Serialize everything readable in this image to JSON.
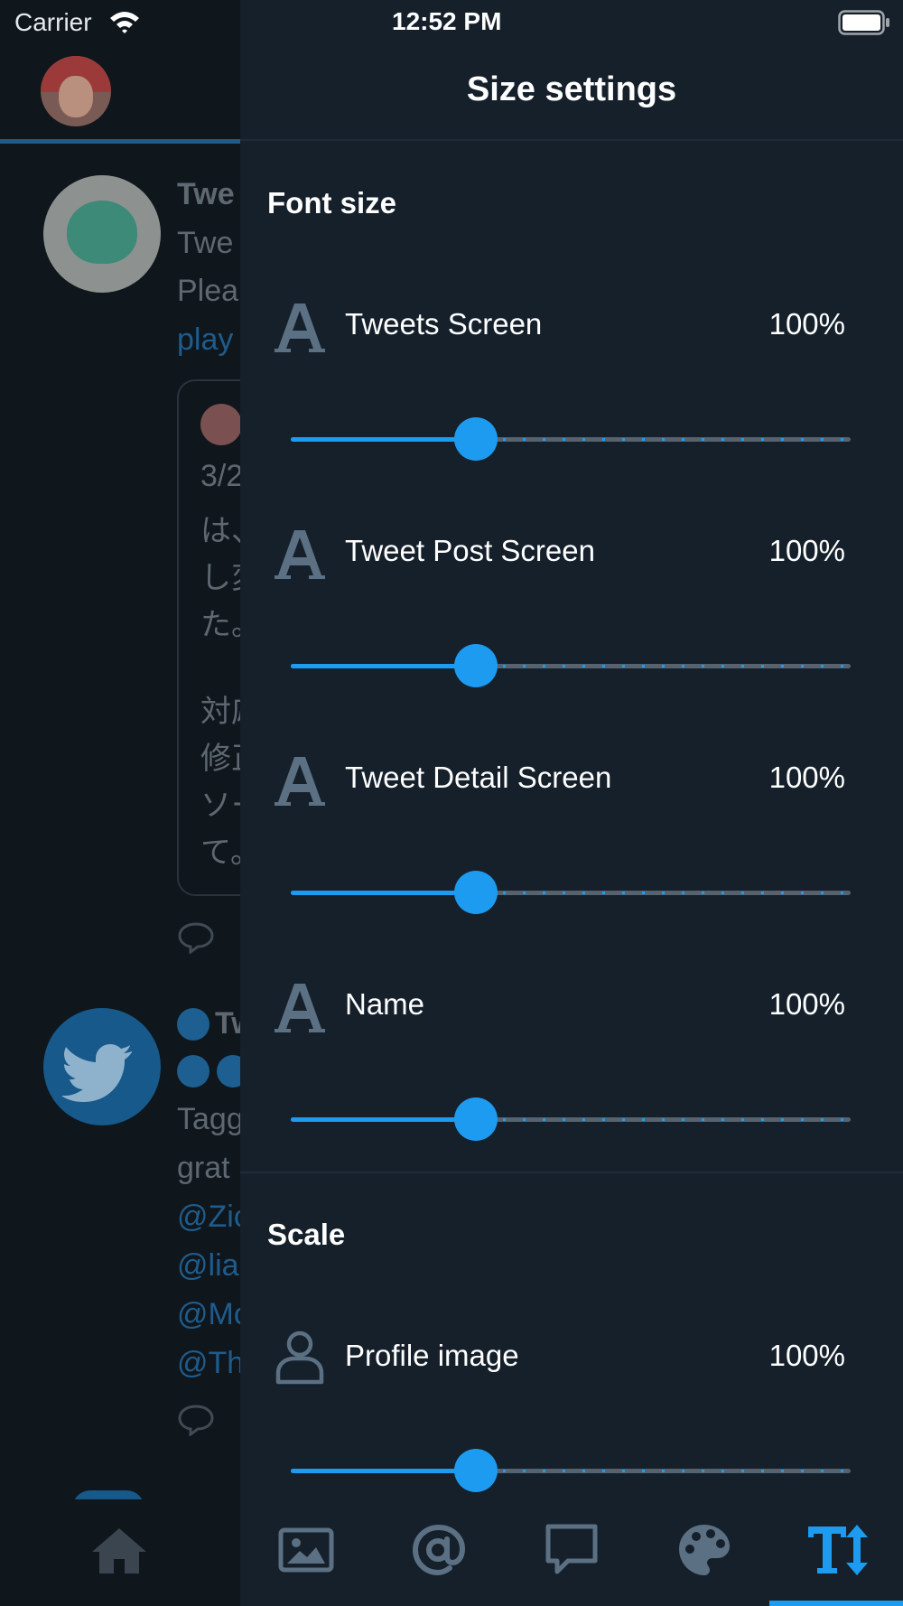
{
  "status_bar": {
    "carrier": "Carrier",
    "time": "12:52 PM"
  },
  "background_timeline": {
    "tweet1_name": "Twe",
    "tweet1_line1": "Twe",
    "tweet1_line2": "Plea",
    "tweet1_link": "play",
    "quote_lines": [
      "3/2",
      "は、",
      "し変",
      "た。",
      "対応",
      "修正",
      "ソー",
      "て。"
    ],
    "tweet2_name": "Tw",
    "tweet2_line1": "Tagg",
    "tweet2_line2": "grat",
    "tweet2_mentions": [
      "@Zic",
      "@lia",
      "@Mc",
      "@Th"
    ]
  },
  "panel": {
    "title": "Size settings",
    "font_size_section": {
      "title": "Font size",
      "items": [
        {
          "label": "Tweets Screen",
          "value": "100%",
          "icon": "font-a-icon",
          "level": 0.33
        },
        {
          "label": "Tweet Post Screen",
          "value": "100%",
          "icon": "font-a-icon",
          "level": 0.33
        },
        {
          "label": "Tweet Detail Screen",
          "value": "100%",
          "icon": "font-a-icon",
          "level": 0.33
        },
        {
          "label": "Name",
          "value": "100%",
          "icon": "font-a-icon",
          "level": 0.33
        }
      ]
    },
    "scale_section": {
      "title": "Scale",
      "items": [
        {
          "label": "Profile image",
          "value": "100%",
          "icon": "person-icon",
          "level": 0.33
        }
      ]
    }
  },
  "tab_bar": {
    "tabs": [
      {
        "name": "home-tab",
        "icon": "home-icon"
      },
      {
        "name": "media-tab",
        "icon": "image-icon"
      },
      {
        "name": "mentions-tab",
        "icon": "at-icon"
      },
      {
        "name": "messages-tab",
        "icon": "chat-bubble-icon"
      },
      {
        "name": "theme-tab",
        "icon": "palette-icon"
      },
      {
        "name": "size-settings-tab",
        "icon": "text-size-icon",
        "active": true
      }
    ]
  },
  "colors": {
    "accent": "#1d9bf0",
    "panel_background": "#15202b",
    "icon_gray": "#5b7083"
  }
}
